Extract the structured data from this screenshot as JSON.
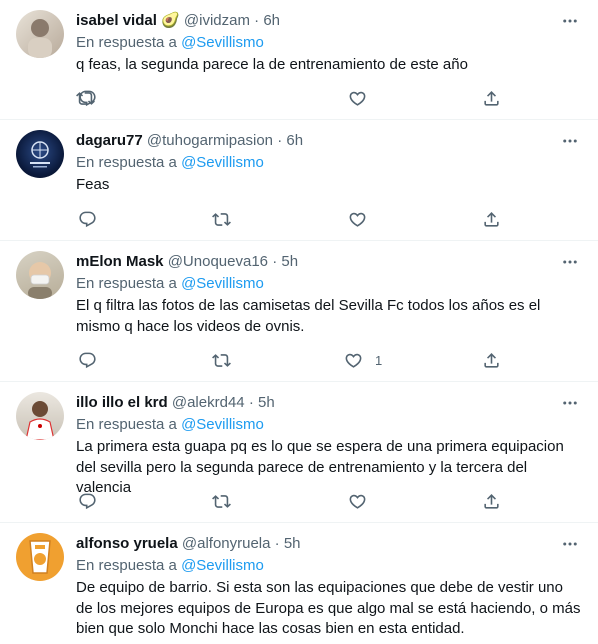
{
  "reply_prefix": "En respuesta a",
  "icons": {
    "reply": "reply-icon",
    "retweet": "retweet-icon",
    "like": "heart-icon",
    "share": "share-icon",
    "more": "more-dots-icon"
  },
  "colors": {
    "mention": "#1d9bf0",
    "secondary": "#536471",
    "text": "#0f1419"
  },
  "tweets": [
    {
      "name": "isabel vidal 🥑",
      "handle": "@ividzam",
      "dot": "·",
      "time": "6h",
      "reply_to": "@Sevillismo",
      "text": "q feas, la segunda parece la de entrenamiento de este año",
      "likes": ""
    },
    {
      "name": "dagaru77",
      "handle": "@tuhogarmipasion",
      "dot": "·",
      "time": "6h",
      "reply_to": "@Sevillismo",
      "text": "Feas",
      "likes": ""
    },
    {
      "name": "mElon Mask",
      "handle": "@Unoqueva16",
      "dot": "·",
      "time": "5h",
      "reply_to": "@Sevillismo",
      "text": "El q filtra las fotos de las camisetas del Sevilla Fc todos los años es el mismo q hace los videos de ovnis.",
      "likes": "1"
    },
    {
      "name": "illo illo el krd",
      "handle": "@alekrd44",
      "dot": "·",
      "time": "5h",
      "reply_to": "@Sevillismo",
      "text": "La primera esta guapa pq es lo que se espera de una primera equipacion del sevilla pero la segunda parece de entrenamiento y la tercera del valencia",
      "likes": ""
    },
    {
      "name": "alfonso yruela",
      "handle": "@alfonyruela",
      "dot": "·",
      "time": "5h",
      "reply_to": "@Sevillismo",
      "text": "De equipo de barrio. Si esta son las equipaciones que debe de vestir uno de los mejores equipos de Europa es que algo mal se está haciendo, o más bien que solo Monchi hace las cosas bien en esta entidad.",
      "likes": ""
    }
  ]
}
